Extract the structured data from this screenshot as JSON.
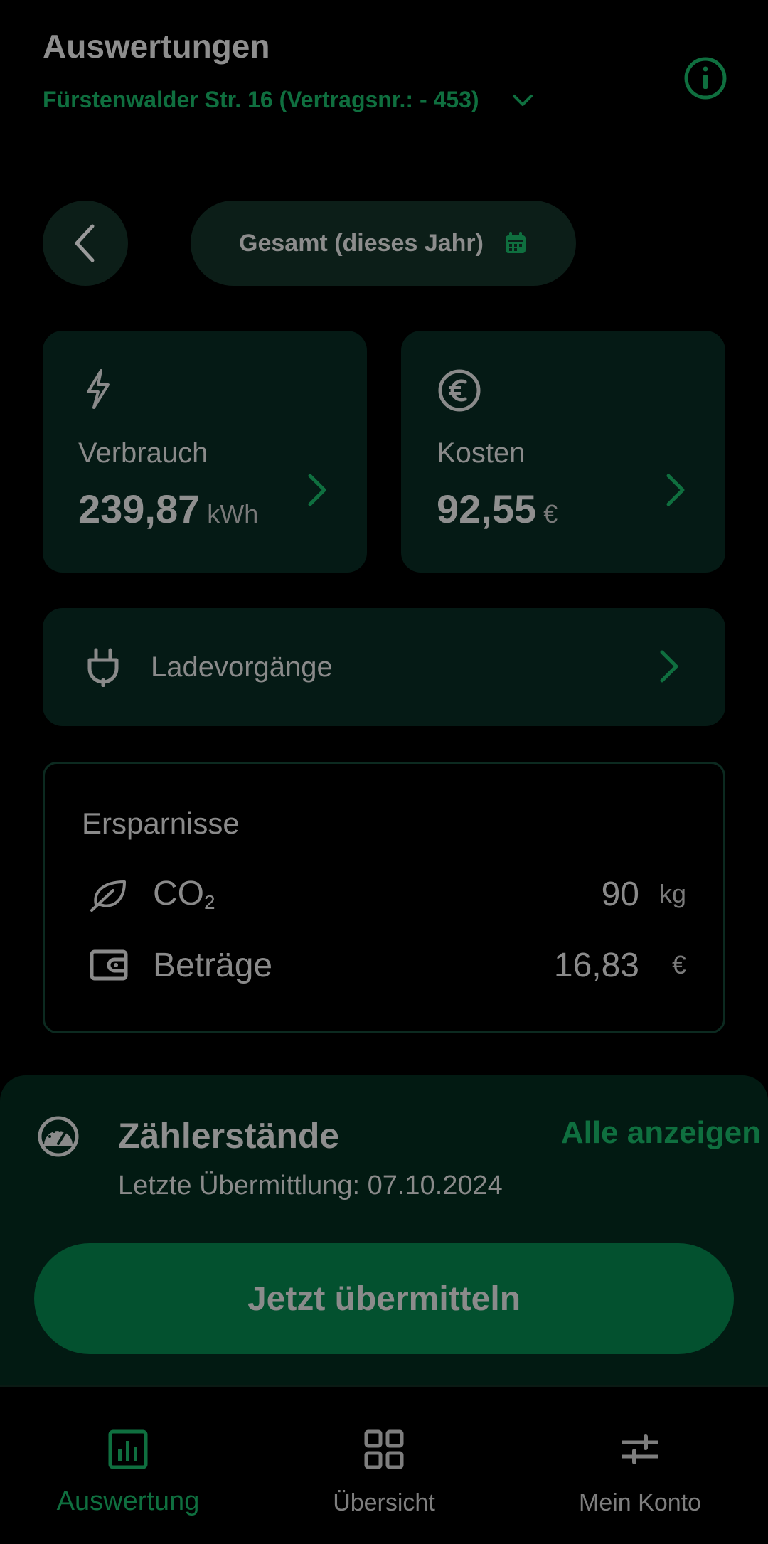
{
  "header": {
    "title": "Auswertungen",
    "address": "Fürstenwalder Str.  16 (Vertragsnr.: - 453)"
  },
  "period": {
    "label": "Gesamt (dieses Jahr)"
  },
  "cards": {
    "usage": {
      "label": "Verbrauch",
      "value": "239,87",
      "unit": "kWh"
    },
    "cost": {
      "label": "Kosten",
      "value": "92,55",
      "unit": "€"
    }
  },
  "charging": {
    "label": "Ladevorgänge"
  },
  "savings": {
    "title": "Ersparnisse",
    "co2": {
      "label": "CO",
      "sub": "2",
      "value": "90",
      "unit": "kg"
    },
    "amount": {
      "label": "Beträge",
      "value": "16,83",
      "unit": "€"
    }
  },
  "meter": {
    "title": "Zählerstände",
    "link": "Alle anzeigen",
    "subtitle": "Letzte Übermittlung: 07.10.2024",
    "button": "Jetzt übermitteln"
  },
  "nav": [
    {
      "label": "Auswertung",
      "icon": "bar-chart-icon",
      "active": true
    },
    {
      "label": "Übersicht",
      "icon": "grid-icon",
      "active": false
    },
    {
      "label": "Mein Konto",
      "icon": "sliders-icon",
      "active": false
    }
  ],
  "colors": {
    "accent": "#0f6f3f",
    "button": "#03512f",
    "card": "#051a15",
    "panel": "#021a12",
    "background": "#000000"
  }
}
